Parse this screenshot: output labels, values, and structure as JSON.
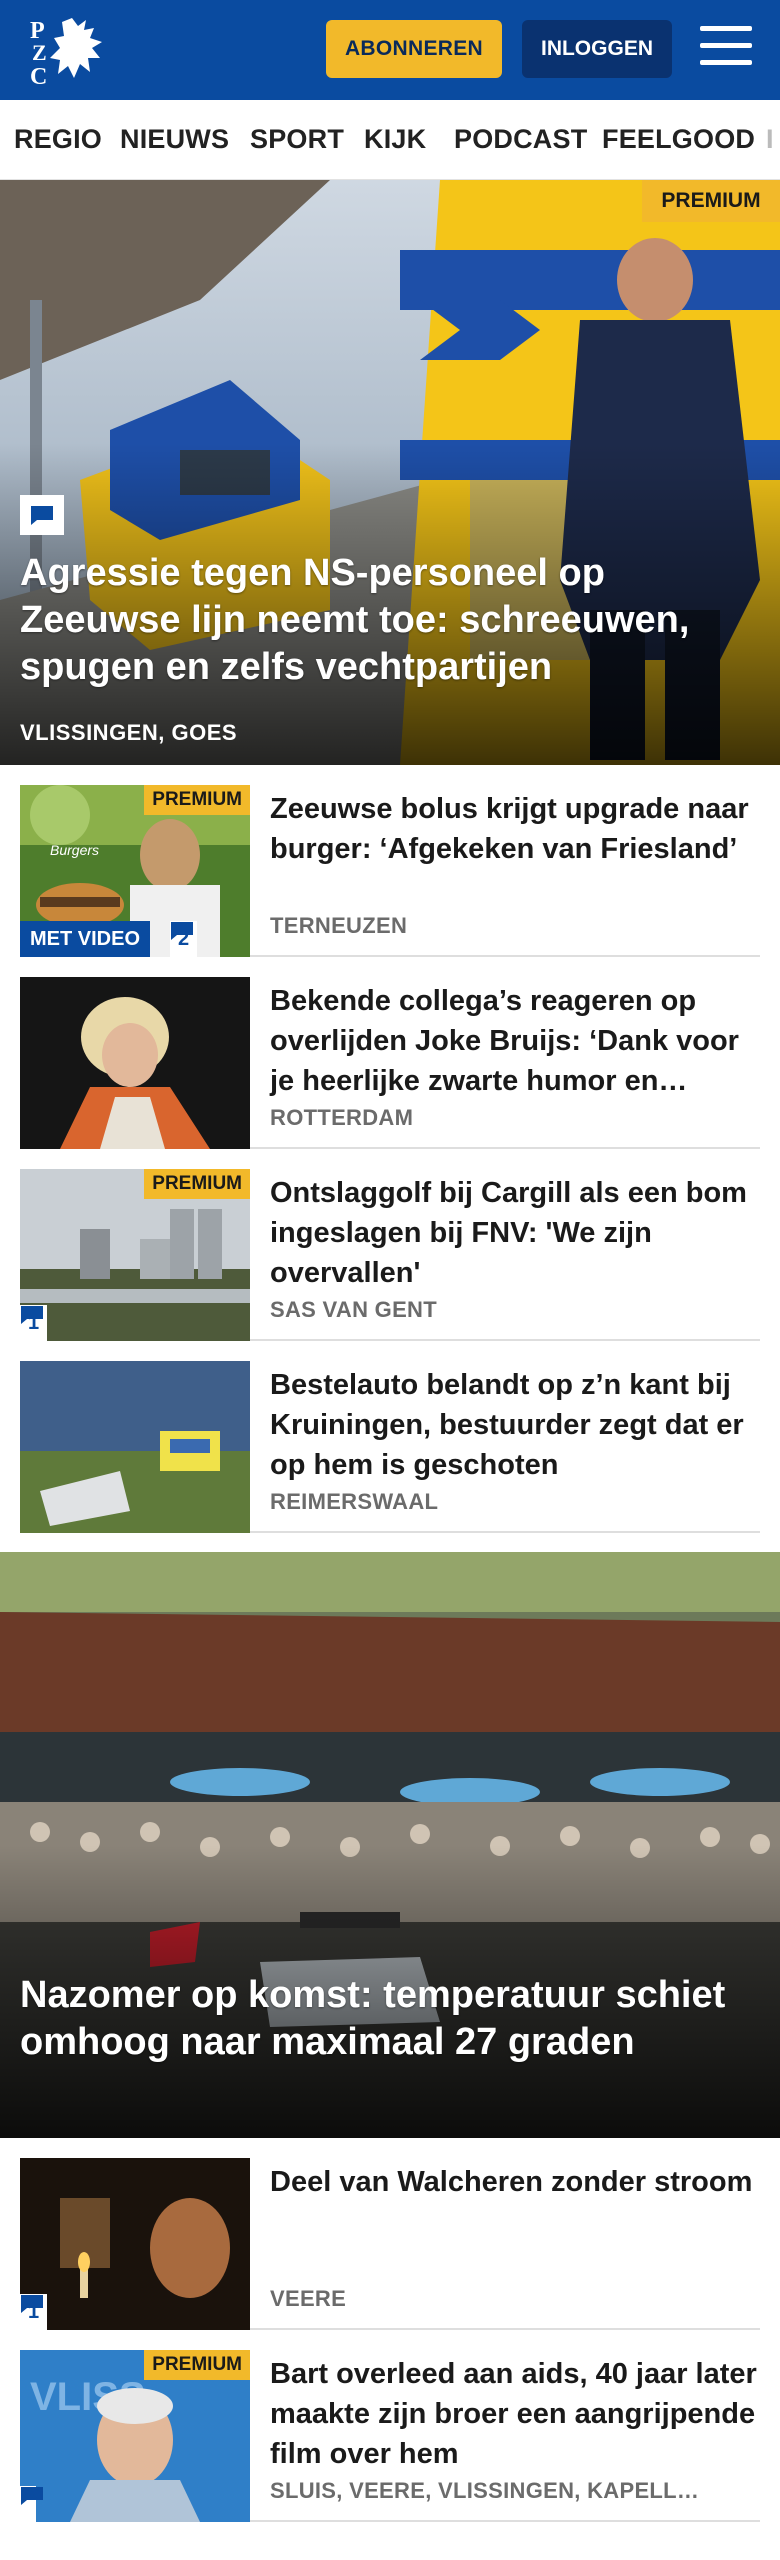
{
  "header": {
    "logo_text": "PZC",
    "subscribe_label": "ABONNEREN",
    "login_label": "INLOGGEN",
    "colors": {
      "brand": "#0a4ba0",
      "accent": "#f2b92a"
    }
  },
  "nav": {
    "items": [
      "REGIO",
      "NIEUWS",
      "SPORT",
      "KIJK",
      "PODCAST",
      "FEELGOOD",
      "I"
    ]
  },
  "hero": {
    "premium_label": "PREMIUM",
    "title": "Agressie tegen NS-personeel op Zeeuwse lijn neemt toe: schreeuwen, spugen en zelfs vechtpartijen",
    "location": "VLISSINGEN, GOES",
    "comment_icon": "speech-bubble-icon"
  },
  "articles": [
    {
      "title": "Zeeuwse bolus krijgt upgrade naar burger: ‘Afgekeken van Friesland’",
      "location": "TERNEUZEN",
      "premium_label": "PREMIUM",
      "video_label": "MET VIDEO",
      "comments": "2"
    },
    {
      "title": "Bekende collega’s reageren op overlijden Joke Bruijs: ‘Dank voor je heerlijke zwarte humor en…",
      "location": "ROTTERDAM"
    },
    {
      "title": "Ontslaggolf bij Cargill als een bom ingeslagen bij FNV: 'We zijn overvallen'",
      "location": "SAS VAN GENT",
      "premium_label": "PREMIUM",
      "comments": "1"
    },
    {
      "title": "Bestelauto belandt op z’n kant bij Kruiningen, bestuurder zegt dat er op hem is geschoten",
      "location": "REIMERSWAAL"
    }
  ],
  "hero2": {
    "title": "Nazomer op komst: temperatuur schiet omhoog naar maximaal 27 graden"
  },
  "articles2": [
    {
      "title": "Deel van Walcheren zonder stroom",
      "location": "VEERE",
      "comments": "1"
    },
    {
      "title": "Bart overleed aan aids, 40 jaar later maakte zijn broer een aangrijpende film over hem",
      "location": "SLUIS, VEERE, VLISSINGEN, KAPELL…",
      "premium_label": "PREMIUM"
    }
  ]
}
